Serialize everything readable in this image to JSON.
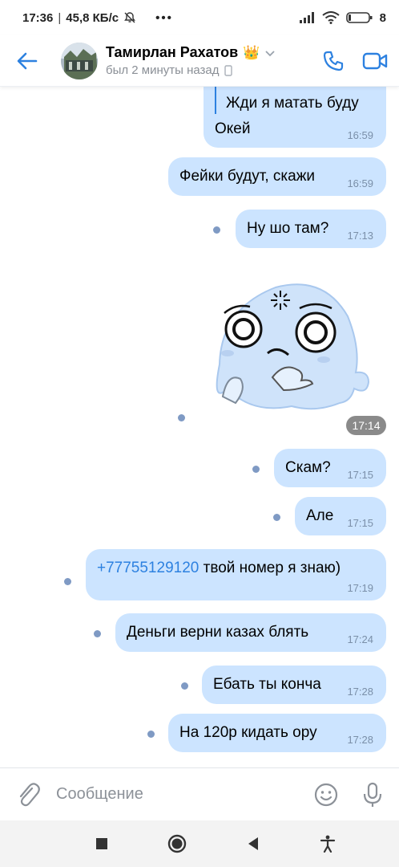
{
  "status_bar": {
    "time": "17:36",
    "speed": "45,8 КБ/с",
    "dots": "•••",
    "battery": "8"
  },
  "header": {
    "name": "Тамирлан Рахатов",
    "crown": "👑",
    "status": "был 2 минуты назад"
  },
  "messages": [
    {
      "text_quote": "Жди я матать буду",
      "text": "Окей",
      "time": "16:59"
    },
    {
      "text": "Фейки будут, скажи",
      "time": "16:59"
    },
    {
      "text": "Ну шо там?",
      "time": "17:13"
    },
    {
      "sticker": "ghost-sticker",
      "time": "17:14"
    },
    {
      "text": "Скам?",
      "time": "17:15"
    },
    {
      "text": "Але",
      "time": "17:15"
    },
    {
      "phone": "+77755129120",
      "text": " твой номер я знаю)",
      "time": "17:19"
    },
    {
      "text": "Деньги верни казах блять",
      "time": "17:24"
    },
    {
      "text": "Ебать ты конча",
      "time": "17:28"
    },
    {
      "text": "На 120р кидать ору",
      "time": "17:28"
    }
  ],
  "composer": {
    "placeholder": "Сообщение"
  },
  "colors": {
    "bubble": "#cce4ff",
    "accent": "#2d81e0"
  }
}
